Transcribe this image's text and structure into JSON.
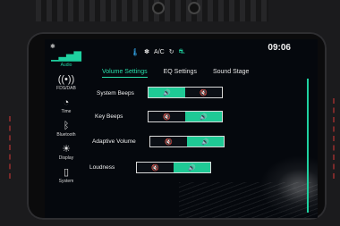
{
  "clock": "09:06",
  "status": {
    "climate_label": "A/C"
  },
  "tabs": [
    {
      "label": "Volume Settings",
      "active": true
    },
    {
      "label": "EQ Settings",
      "active": false
    },
    {
      "label": "Sound Stage",
      "active": false
    }
  ],
  "sidebar": [
    {
      "label": "Audio",
      "icon": "audio-bars-icon",
      "active": true
    },
    {
      "label": "FDS/DAB",
      "icon": "radio-icon",
      "active": false
    },
    {
      "label": "Time",
      "icon": "clock-icon",
      "active": false
    },
    {
      "label": "Bluetooth",
      "icon": "bluetooth-icon",
      "active": false
    },
    {
      "label": "Display",
      "icon": "brightness-icon",
      "active": false
    },
    {
      "label": "System",
      "icon": "phone-settings-icon",
      "active": false
    }
  ],
  "rows": [
    {
      "label": "System Beeps",
      "on_segment": "left"
    },
    {
      "label": "Key Beeps",
      "on_segment": "right"
    },
    {
      "label": "Adaptive Volume",
      "on_segment": "right"
    },
    {
      "label": "Loudness",
      "on_segment": "right"
    }
  ],
  "colors": {
    "accent": "#1fc995",
    "text": "#efefef",
    "background": "#05080d"
  }
}
